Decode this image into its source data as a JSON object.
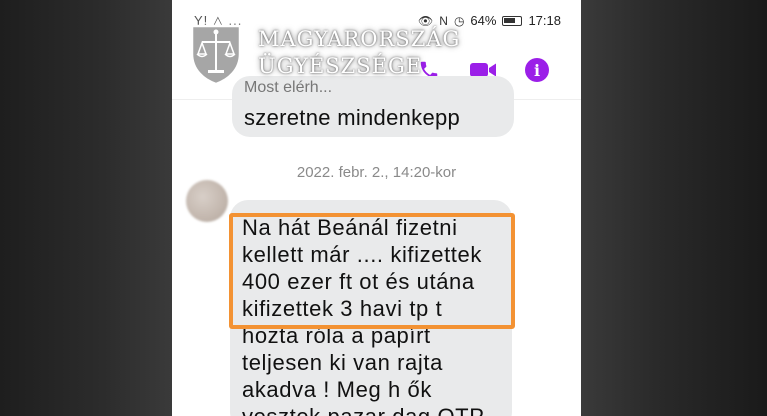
{
  "status_bar": {
    "left_text": "Y!  △  ...",
    "battery_percent": "64%",
    "time": "17:18"
  },
  "watermark": {
    "line1": "MAGYARORSZÁG",
    "line2": "ÜGYÉSZSÉGE"
  },
  "header": {
    "accent_color": "#9b1fe8",
    "icons": [
      "phone-icon",
      "video-camera-icon",
      "info-icon"
    ]
  },
  "conversation": {
    "quoted_preview": "Most elérh...",
    "first_message": "szeretne mindenkepp",
    "timestamp": "2022. febr. 2., 14:20-kor",
    "second_message": "Na hát Beánál fizetni\nkellett már .... kifizettek\n400 ezer ft ot és utána\nkifizettek 3 havi tp t\nhozta róla a papírt\nteljesen ki van rajta\nakadva ! Meg h ők\nvesztek pazar dag OTP"
  },
  "highlight_color": "#f39233"
}
